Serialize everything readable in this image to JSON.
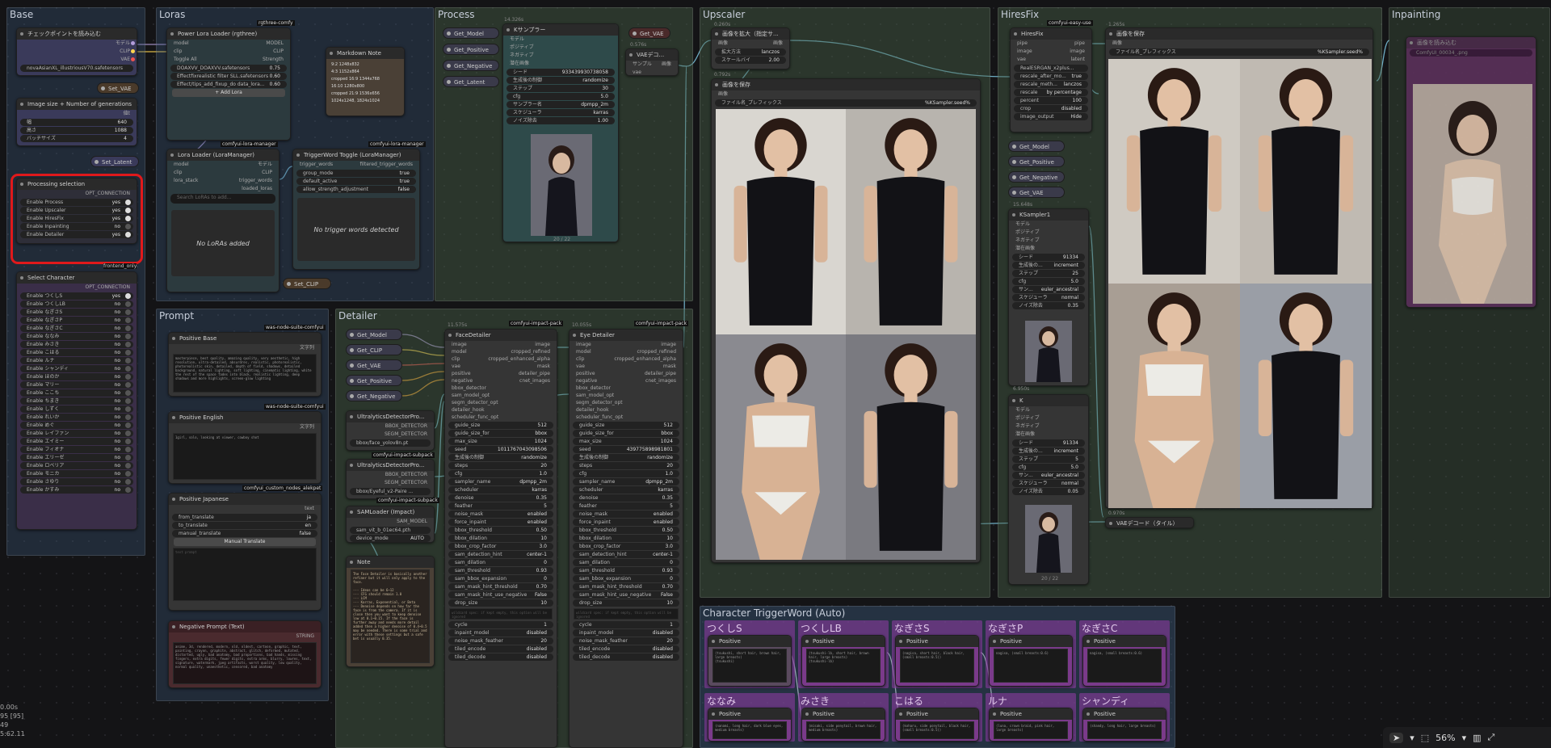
{
  "groups": {
    "base": "Base",
    "loras": "Loras",
    "process": "Process",
    "upscaler": "Upscaler",
    "hiresfix": "HiresFix",
    "inpainting": "Inpainting",
    "prompt": "Prompt",
    "detailer": "Detailer",
    "char_trigger": "Character TriggerWord (Auto)"
  },
  "base": {
    "ckpt_title": "チェックポイントを読み込む",
    "ckpt_out_model": "モデル",
    "ckpt_out_clip": "CLIP",
    "ckpt_out_vae": "VAE",
    "ckpt_value": "novaAsianXL_illustriousV70.safetensors",
    "set_vae": "Set_VAE",
    "imgsize_title": "Image size + Number of generations",
    "imgsize_out": "値t",
    "w_label": "幅",
    "w_val": "640",
    "h_label": "高さ",
    "h_val": "1088",
    "b_label": "バッチサイズ",
    "b_val": "4",
    "set_latent": "Set_Latent",
    "proc_title": "Processing selection",
    "proc_out": "OPT_CONNECTION",
    "proc_items": [
      {
        "l": "Enable Process",
        "v": "yes"
      },
      {
        "l": "Enable Upscaler",
        "v": "yes"
      },
      {
        "l": "Enable HiresFix",
        "v": "yes"
      },
      {
        "l": "Enable Inpainting",
        "v": "no"
      },
      {
        "l": "Enable Detailer",
        "v": "yes"
      }
    ],
    "frontend_only": "frontend_only",
    "char_title": "Select Character",
    "char_out": "OPT_CONNECTION",
    "char_items": [
      {
        "l": "Enable つくしS",
        "v": "yes"
      },
      {
        "l": "Enable つくしLB",
        "v": "no"
      },
      {
        "l": "Enable なぎさS",
        "v": "no"
      },
      {
        "l": "Enable なぎさP",
        "v": "no"
      },
      {
        "l": "Enable なぎさC",
        "v": "no"
      },
      {
        "l": "Enable ななみ",
        "v": "no"
      },
      {
        "l": "Enable みさき",
        "v": "no"
      },
      {
        "l": "Enable こはる",
        "v": "no"
      },
      {
        "l": "Enable ルナ",
        "v": "no"
      },
      {
        "l": "Enable シャンディ",
        "v": "no"
      },
      {
        "l": "Enable ほのか",
        "v": "no"
      },
      {
        "l": "Enable マリー",
        "v": "no"
      },
      {
        "l": "Enable ここち",
        "v": "no"
      },
      {
        "l": "Enable ちまき",
        "v": "no"
      },
      {
        "l": "Enable しずく",
        "v": "no"
      },
      {
        "l": "Enable れいか",
        "v": "no"
      },
      {
        "l": "Enable めぐ",
        "v": "no"
      },
      {
        "l": "Enable レイファン",
        "v": "no"
      },
      {
        "l": "Enable エイミー",
        "v": "no"
      },
      {
        "l": "Enable フィオナ",
        "v": "no"
      },
      {
        "l": "Enable エリーゼ",
        "v": "no"
      },
      {
        "l": "Enable ロベリア",
        "v": "no"
      },
      {
        "l": "Enable モニカ",
        "v": "no"
      },
      {
        "l": "Enable さゆり",
        "v": "no"
      },
      {
        "l": "Enable かすみ",
        "v": "no"
      }
    ]
  },
  "loras": {
    "power_title": "Power Lora Loader (rgthree)",
    "power_badge": "rgthree-comfy",
    "in_model": "model",
    "in_clip": "clip",
    "out_model": "MODEL",
    "out_clip": "CLIP",
    "toggle_all": "Toggle All",
    "strength": "Strength",
    "power_items": [
      {
        "l": "DOAXVV_DOAXVV.safetensors",
        "v": "0.75"
      },
      {
        "l": "Effectfixrealistic filter SLL.safetensors",
        "v": "0.60"
      },
      {
        "l": "Effect/tips_add_fixup_do data_lora...",
        "v": "0.60"
      }
    ],
    "add_lora": "+ Add Lora",
    "md_title": "Markdown Note",
    "md_lines": [
      "9:2 1248x832",
      "4:3 1152x864",
      "cropped 16:9 1344x768",
      "16:10 1280x800",
      "cropped 21:9 1536x656",
      "1024x1248, 1824x1024"
    ],
    "lm_badge": "comfyui-lora-manager",
    "lm_title": "Lora Loader (LoraManager)",
    "lm_in_model": "model",
    "lm_in_clip": "clip",
    "lm_in_stack": "lora_stack",
    "lm_out_model": "モデル",
    "lm_out_clip": "CLIP",
    "lm_out_trigger": "trigger_words",
    "lm_out_loaded": "loaded_loras",
    "lm_search": "Search LoRAs to add...",
    "no_loras": "No LoRAs added",
    "tw_badge": "comfyui-lora-manager",
    "tw_title": "TriggerWord Toggle (LoraManager)",
    "tw_in": "trigger_words",
    "tw_out": "filtered_trigger_words",
    "tw_items": [
      {
        "l": "group_mode",
        "v": "true"
      },
      {
        "l": "default_active",
        "v": "true"
      },
      {
        "l": "allow_strength_adjustment",
        "v": "false"
      }
    ],
    "no_trigger": "No trigger words detected",
    "set_clip": "Set_CLIP"
  },
  "process": {
    "gets": [
      "Get_Model",
      "Get_Positive",
      "Get_Negative",
      "Get_Latent"
    ],
    "get_vae": "Get_VAE",
    "time": "14.326s",
    "ks_title": "Kサンプラー",
    "ks_in": [
      "モデル",
      "ポジティブ",
      "ネガティブ",
      "潜在画像"
    ],
    "ks_out": "潜在",
    "ks_items": [
      {
        "l": "シード",
        "v": "933439930738058"
      },
      {
        "l": "生成後の制御",
        "v": "randomize"
      },
      {
        "l": "ステップ",
        "v": "30"
      },
      {
        "l": "cfg",
        "v": "5.0"
      },
      {
        "l": "サンプラー名",
        "v": "dpmpp_2m"
      },
      {
        "l": "スケジューラ",
        "v": "karras"
      },
      {
        "l": "ノイズ除去",
        "v": "1.00"
      }
    ],
    "vae_time": "0.576s",
    "vae_title": "VAEデコ...",
    "vae_in1": "サンプル",
    "vae_in2": "vae",
    "vae_out": "画像",
    "thumb_label": "20 / 22"
  },
  "upscaler": {
    "t1": "0.260s",
    "n1_title": "画像を拡大（指定サ...",
    "n1_in": "画像",
    "n1_out": "画像",
    "n1_items": [
      {
        "l": "拡大方法",
        "v": "lanczos"
      },
      {
        "l": "スケールバイ",
        "v": "2.00"
      }
    ],
    "t2": "0.792s",
    "n2_title": "画像を保存",
    "n2_in": "画像",
    "n2_prefix_l": "ファイル名_プレフィックス",
    "n2_prefix_v": "%KSampler.seed%"
  },
  "hires": {
    "badge": "comfyui-easy-use",
    "t1": "1.265s",
    "hf_title": "HiresFix",
    "hf_in": [
      "pipe",
      "image",
      "vae"
    ],
    "hf_out": [
      "pipe",
      "image",
      "latent"
    ],
    "hf_items": [
      {
        "l": "RealESRGAN_x2plus...",
        "v": ""
      },
      {
        "l": "rescale_after_mo...",
        "v": "true"
      },
      {
        "l": "rescale_meth...",
        "v": "lanczos"
      },
      {
        "l": "rescale",
        "v": "by percentage"
      },
      {
        "l": "percent",
        "v": "100"
      },
      {
        "l": "crop",
        "v": "disabled"
      },
      {
        "l": "image_output",
        "v": "Hide"
      }
    ],
    "gets": [
      "Get_Model",
      "Get_Positive",
      "Get_Negative",
      "Get_VAE"
    ],
    "ks1_time": "15.648s",
    "ks1_title": "KSampler1",
    "ks_in": [
      "モデル",
      "ポジティブ",
      "ネガティブ",
      "潜在画像"
    ],
    "ks_out": "潜在",
    "ks1_items": [
      {
        "l": "シード",
        "v": "91334"
      },
      {
        "l": "生成後の...",
        "v": "increment"
      },
      {
        "l": "ステップ",
        "v": "25"
      },
      {
        "l": "cfg",
        "v": "5.0"
      },
      {
        "l": "サン...",
        "v": "euler_ancestral"
      },
      {
        "l": "スケジューラ",
        "v": "normal"
      },
      {
        "l": "ノイズ除去",
        "v": "0.35"
      }
    ],
    "ks2_time": "6.950s",
    "ks2_title": "K",
    "ks2_items": [
      {
        "l": "シード",
        "v": "91334"
      },
      {
        "l": "生成後の...",
        "v": "increment"
      },
      {
        "l": "ステップ",
        "v": "5"
      },
      {
        "l": "cfg",
        "v": "5.0"
      },
      {
        "l": "サン...",
        "v": "euler_ancestral"
      },
      {
        "l": "スケジューラ",
        "v": "normal"
      },
      {
        "l": "ノイズ除去",
        "v": "0.05"
      }
    ],
    "save_time": "1.265s",
    "save_title": "画像を保存",
    "save_in": "画像",
    "save_prefix_l": "ファイル名_プレフィックス",
    "save_prefix_v": "%KSampler.seed%",
    "vae_time": "0.970s",
    "vae_title": "VAEデコード（タイル）",
    "thumb_label": "20 / 22"
  },
  "inpaint": {
    "title": "画像を読み込む",
    "file": "ComfyUI_00034_.png"
  },
  "prompt": {
    "pb_badge": "was-node-suite-comfyui",
    "pb_title": "Positive Base",
    "pb_out": "文字列",
    "pb_text": "masterpiece, best quality, amazing quality, very aesthetic, high resolution, ultra-detailed, absurdres, realistic, photorealistic, photorealistic skin, detailed, depth of field, shadows, detailed background, natural lighting, soft lighting, cinematic lighting, white the rest of the space fades into black, realistic lighting, deep shadows and more highlights, screen-glow lighting",
    "pe_badge": "was-node-suite-comfyui",
    "pe_title": "Positive English",
    "pe_out": "文字列",
    "pe_text": "1girl, solo, looking at viewer, cowboy shot",
    "pj_badge": "comfyui_custom_nodes_alekpet",
    "pj_title": "Positive Japanese",
    "pj_out": "text",
    "pj_items": [
      {
        "l": "from_translate",
        "v": "ja"
      },
      {
        "l": "to_translate",
        "v": "en"
      },
      {
        "l": "manual_translate",
        "v": "false"
      }
    ],
    "pj_btn": "Manual Translate",
    "pj_ph": "text prompt",
    "neg_title": "Negative Prompt (Text)",
    "neg_out": "STRING",
    "neg_text": "anime, 3d, rendered, modern, old, oldest, cartoon, graphic, text, painting, crayon, graphite, abstract, glitch, deformed, mutated, distorted, ugly, bad anatomy, bad proportions, bad hands, missing fingers, extra digits, fewer digits, extra arms, blurry, lowres, text, signature, watermark, jpeg artifacts, worst quality, low quality, normal quality, unaesthetic, censored, bad anatomy"
  },
  "detailer": {
    "gets": [
      "Get_Model",
      "Get_CLIP",
      "Get_VAE",
      "Get_Positive",
      "Get_Negative"
    ],
    "fd_badge": "comfyui-impact-pack",
    "fd_time": "11.575s",
    "fd_title": "FaceDetailer",
    "ed_badge": "comfyui-impact-pack",
    "ed_time": "10.055s",
    "ed_title": "Eye Detailer",
    "in": [
      "image",
      "model",
      "clip",
      "vae",
      "positive",
      "negative",
      "bbox_detector",
      "sam_model_opt",
      "segm_detector_opt",
      "detailer_hook",
      "scheduler_func_opt"
    ],
    "out": [
      "image",
      "cropped_refined",
      "cropped_enhanced_alpha",
      "mask",
      "detailer_pipe",
      "cnet_images"
    ],
    "fd_items": [
      {
        "l": "guide_size",
        "v": "512"
      },
      {
        "l": "guide_size_for",
        "v": "bbox"
      },
      {
        "l": "max_size",
        "v": "1024"
      },
      {
        "l": "seed",
        "v": "1011767043098506"
      },
      {
        "l": "生成後の制御",
        "v": "randomize"
      },
      {
        "l": "steps",
        "v": "20"
      },
      {
        "l": "cfg",
        "v": "1.0"
      },
      {
        "l": "sampler_name",
        "v": "dpmpp_2m"
      },
      {
        "l": "scheduler",
        "v": "karras"
      },
      {
        "l": "denoise",
        "v": "0.35"
      },
      {
        "l": "feather",
        "v": "5"
      },
      {
        "l": "noise_mask",
        "v": "enabled"
      },
      {
        "l": "force_inpaint",
        "v": "enabled"
      },
      {
        "l": "bbox_threshold",
        "v": "0.50"
      },
      {
        "l": "bbox_dilation",
        "v": "10"
      },
      {
        "l": "bbox_crop_factor",
        "v": "3.0"
      },
      {
        "l": "sam_detection_hint",
        "v": "center-1"
      },
      {
        "l": "sam_dilation",
        "v": "0"
      },
      {
        "l": "sam_threshold",
        "v": "0.93"
      },
      {
        "l": "sam_bbox_expansion",
        "v": "0"
      },
      {
        "l": "sam_mask_hint_threshold",
        "v": "0.70"
      },
      {
        "l": "sam_mask_hint_use_negative",
        "v": "False"
      },
      {
        "l": "drop_size",
        "v": "10"
      }
    ],
    "ed_items": [
      {
        "l": "guide_size",
        "v": "512"
      },
      {
        "l": "guide_size_for",
        "v": "bbox"
      },
      {
        "l": "max_size",
        "v": "1024"
      },
      {
        "l": "seed",
        "v": "439775898981801"
      },
      {
        "l": "生成後の制御",
        "v": "randomize"
      },
      {
        "l": "steps",
        "v": "20"
      },
      {
        "l": "cfg",
        "v": "1.0"
      },
      {
        "l": "sampler_name",
        "v": "dpmpp_2m"
      },
      {
        "l": "scheduler",
        "v": "karras"
      },
      {
        "l": "denoise",
        "v": "0.35"
      },
      {
        "l": "feather",
        "v": "5"
      },
      {
        "l": "noise_mask",
        "v": "enabled"
      },
      {
        "l": "force_inpaint",
        "v": "enabled"
      },
      {
        "l": "bbox_threshold",
        "v": "0.50"
      },
      {
        "l": "bbox_dilation",
        "v": "10"
      },
      {
        "l": "bbox_crop_factor",
        "v": "3.0"
      },
      {
        "l": "sam_detection_hint",
        "v": "center-1"
      },
      {
        "l": "sam_dilation",
        "v": "0"
      },
      {
        "l": "sam_threshold",
        "v": "0.93"
      },
      {
        "l": "sam_bbox_expansion",
        "v": "0"
      },
      {
        "l": "sam_mask_hint_threshold",
        "v": "0.70"
      },
      {
        "l": "sam_mask_hint_use_negative",
        "v": "False"
      },
      {
        "l": "drop_size",
        "v": "10"
      }
    ],
    "wildcard_ph": "wildcard spec: if kept empty, this option will be ignored",
    "tail_items": [
      {
        "l": "cycle",
        "v": "1"
      },
      {
        "l": "inpaint_model",
        "v": "disabled"
      },
      {
        "l": "noise_mask_feather",
        "v": "20"
      },
      {
        "l": "tiled_encode",
        "v": "disabled"
      },
      {
        "l": "tiled_decode",
        "v": "disabled"
      }
    ],
    "u1_badge": "comfyui-impact-subpack",
    "u1_title": "UltralyticsDetectorPro...",
    "u1_out1": "BBOX_DETECTOR",
    "u1_out2": "SEGM_DETECTOR",
    "u1_val": "bbox/face_yolov8n.pt",
    "u2_badge": "comfyui-impact-subpack",
    "u2_title": "UltralyticsDetectorPro...",
    "u2_out1": "BBOX_DETECTOR",
    "u2_out2": "SEGM_DETECTOR",
    "u2_val": "bbox/Eyeful_v2-Paire ...",
    "sam_badge": "comfyui-impact-pack",
    "sam_title": "SAMLoader (Impact)",
    "sam_out": "SAM_MODEL",
    "sam_items": [
      {
        "l": "sam_vit_b_01ec64.pth",
        "v": ""
      },
      {
        "l": "device_mode",
        "v": "AUTO"
      }
    ],
    "note_title": "Note",
    "note_text": "The Face Detailer is basically another refiner but it will only apply to the face.\n\n--- Ideas can be 6~12\n--- CFG should remain 1.0\n--- LCM\n--- Karras, Exponential, or Beta\n--- Denoise depends on how far the face is from the camera. If it is close then you want to keep denoise low at 0.1~0.15. If the face is further away and needs more detail added then a higher denoise of 0.4~0.5 may be needed. There is some trial and error with these settings but a safe bet is usually 0.35."
  },
  "char_trigger": {
    "nodes": [
      {
        "t": "つくしS",
        "h": "Positive",
        "txt": "(tsukushi, short hair, brown hair, large breasts)\n(tsukushi)"
      },
      {
        "t": "つくしLB",
        "h": "Positive",
        "txt": "(tsukushi-lb, short hair, brown hair, large breasts)\n(tsukushi-lb)"
      },
      {
        "t": "なぎさS",
        "h": "Positive",
        "txt": "(nagisa, short hair, black hair, (small breasts:0.5))"
      },
      {
        "t": "なぎさP",
        "h": "Positive",
        "txt": "nagisa, (small breasts:0.6)"
      },
      {
        "t": "なぎさC",
        "h": "Positive",
        "txt": "nagisa, (small breasts:0.6)"
      },
      {
        "t": "ななみ",
        "h": "Positive",
        "txt": "(nanami, long hair, dark blue eyes, medium breasts)"
      },
      {
        "t": "みさき",
        "h": "Positive",
        "txt": "(misaki, side ponytail, brown hair, medium breasts)"
      },
      {
        "t": "こはる",
        "h": "Positive",
        "txt": "(koharu, side ponytail, black hair, (small breasts:0.5))"
      },
      {
        "t": "ルナ",
        "h": "Positive",
        "txt": "(luna, crown braid, pink hair, large breasts)"
      },
      {
        "t": "シャンディ",
        "h": "Positive",
        "txt": "(shandy, long hair, large breasts)"
      }
    ]
  },
  "status": {
    "line1": "0.00s",
    "line2": "95 [95]",
    "line3": "49",
    "line4": "5:62.11"
  },
  "toolbar": {
    "zoom": "56%"
  }
}
